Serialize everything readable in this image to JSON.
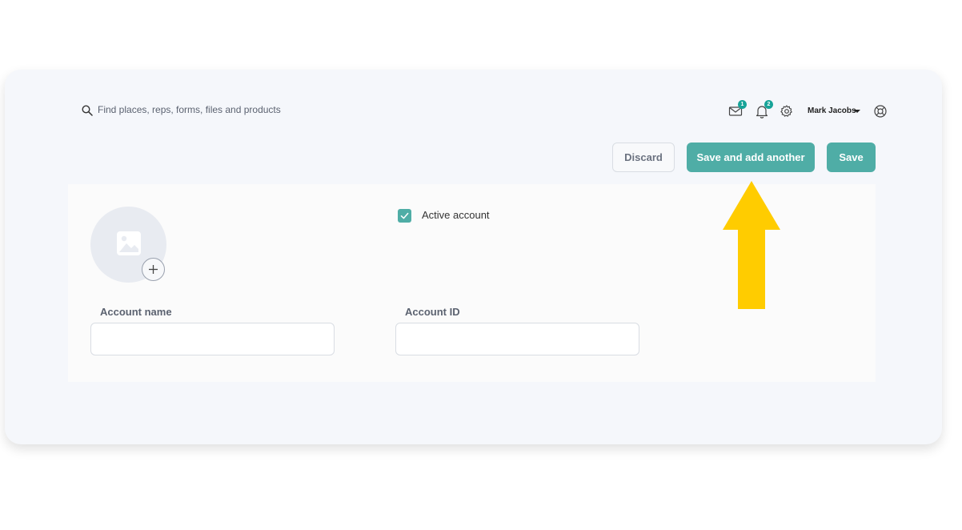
{
  "topbar": {
    "search_placeholder": "Find places, reps, forms, files and products",
    "mail_badge": "1",
    "notifications_badge": "2",
    "user_name": "Mark Jacobs"
  },
  "actions": {
    "discard_label": "Discard",
    "save_and_add_label": "Save and add another",
    "save_label": "Save"
  },
  "form": {
    "active_account_label": "Active account",
    "active_account_checked": true,
    "account_name_label": "Account name",
    "account_name_value": "",
    "account_id_label": "Account ID",
    "account_id_value": ""
  },
  "colors": {
    "accent": "#4fada6",
    "badge": "#17a398",
    "annotation_arrow": "#ffcc00"
  },
  "icons": {
    "search": "search-icon",
    "mail": "mail-icon",
    "bell": "bell-icon",
    "settings": "gear-icon",
    "help": "lifebuoy-icon",
    "avatar_placeholder": "image-icon",
    "add": "plus-icon"
  }
}
